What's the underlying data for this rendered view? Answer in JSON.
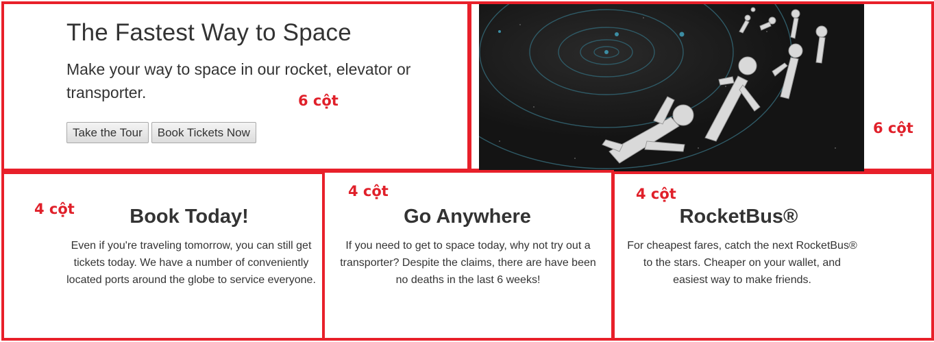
{
  "hero": {
    "title": "The Fastest Way to Space",
    "lead": "Make your way to space in our rocket, elevator or transporter.",
    "buttons": {
      "tour": "Take the Tour",
      "book": "Book Tickets Now"
    },
    "label_left": "6 cột",
    "label_right": "6 cột"
  },
  "columns": [
    {
      "label": "4 cột",
      "title": "Book Today!",
      "body": "Even if you're traveling tomorrow, you can still get tickets today. We have a number of conveniently located ports around the globe to service everyone."
    },
    {
      "label": "4 cột",
      "title": "Go Anywhere",
      "body": "If you need to get to space today, why not try out a transporter? Despite the claims, there are have been no deaths in the last 6 weeks!"
    },
    {
      "label": "4 cột",
      "title": "RocketBus®",
      "body": "For cheapest fares, catch the next RocketBus® to the stars. Cheaper on your wallet, and easiest way to make friends."
    }
  ],
  "colors": {
    "annotation_border": "#e8202a",
    "annotation_text": "#e0202a",
    "space_bg": "#1a1a1a"
  }
}
